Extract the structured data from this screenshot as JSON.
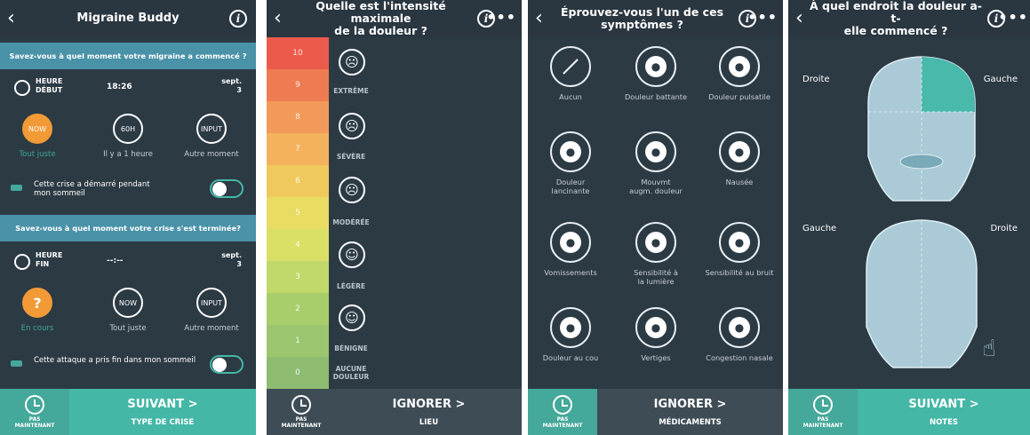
{
  "screen1": {
    "title": "Migraine Buddy",
    "q_start": "Savez-vous à quel moment votre migraine a commencé ?",
    "start_label": "HEURE\nDÉBUT",
    "start_time": "18:26",
    "start_date": "sept.\n3",
    "choices_start": [
      {
        "icon_text": "NOW",
        "caption": "Tout juste"
      },
      {
        "icon_text": "60H",
        "caption": "Il y a 1 heure"
      },
      {
        "icon_text": "INPUT",
        "caption": "Autre moment"
      }
    ],
    "sleep_start": "Cette crise a démarré pendant\nmon sommeil",
    "q_end": "Savez-vous à quel moment votre crise s'est terminée?",
    "end_label": "HEURE\nFIN",
    "end_time": "--:--",
    "end_date": "sept.\n3",
    "choices_end": [
      {
        "icon_text": "?",
        "caption": "En cours"
      },
      {
        "icon_text": "NOW",
        "caption": "Tout juste"
      },
      {
        "icon_text": "INPUT",
        "caption": "Autre moment"
      }
    ],
    "sleep_end": "Cette attaque a pris fin dans mon sommeil",
    "later_label": "PAS\nMAINTENANT",
    "next_label": "SUIVANT >",
    "next_sub": "TYPE DE CRISE"
  },
  "screen2": {
    "title": "Quelle est l'intensité maximale\nde la douleur ?",
    "scale": [
      "10",
      "9",
      "8",
      "7",
      "6",
      "5",
      "4",
      "3",
      "2",
      "1",
      "0"
    ],
    "scale_colors": [
      "#ec5a4b",
      "#ef7b52",
      "#f29a5a",
      "#f3b25b",
      "#f0c95d",
      "#e9dc62",
      "#d9e065",
      "#c1d86a",
      "#a8cd6d",
      "#9bc56f",
      "#8dbb6f"
    ],
    "levels": [
      {
        "label": "EXTRÊME",
        "icon": "face-extreme-icon"
      },
      {
        "label": "SÉVÈRE",
        "icon": "face-severe-icon"
      },
      {
        "label": "MODÉRÉE",
        "icon": "face-moderate-icon"
      },
      {
        "label": "LÉGÈRE",
        "icon": "face-mild-icon"
      },
      {
        "label": "BÉNIGNE",
        "icon": "face-benign-icon"
      },
      {
        "label": "AUCUNE\nDOULEUR",
        "icon": ""
      }
    ],
    "later_label": "PAS\nMAINTENANT",
    "next_label": "IGNORER >",
    "next_sub": "LIEU"
  },
  "screen3": {
    "title": "Éprouvez-vous l'un de ces\nsymptômes ?",
    "symptoms": [
      {
        "caption": "Aucun",
        "icon": "none-icon"
      },
      {
        "caption": "Douleur battante",
        "icon": "throbbing-pain-icon"
      },
      {
        "caption": "Douleur pulsatile",
        "icon": "pulsating-pain-icon"
      },
      {
        "caption": "Douleur\nlancinante",
        "icon": "stabbing-pain-icon"
      },
      {
        "caption": "Mouvmt\naugm. douleur",
        "icon": "movement-pain-icon"
      },
      {
        "caption": "Nausée",
        "icon": "nausea-icon"
      },
      {
        "caption": "Vomissements",
        "icon": "vomiting-icon"
      },
      {
        "caption": "Sensibilité à\nla lumière",
        "icon": "light-sensitivity-icon"
      },
      {
        "caption": "Sensibilité au bruit",
        "icon": "noise-sensitivity-icon"
      },
      {
        "caption": "Douleur au cou",
        "icon": "neck-pain-icon"
      },
      {
        "caption": "Vertiges",
        "icon": "dizziness-icon"
      },
      {
        "caption": "Congestion nasale",
        "icon": "nasal-congestion-icon"
      }
    ],
    "later_label": "PAS\nMAINTENANT",
    "next_label": "IGNORER >",
    "next_sub": "MÉDICAMENTS"
  },
  "screen4": {
    "title": "À quel endroit la douleur a-t-\nelle commencé ?",
    "front_left": "Droite",
    "front_right": "Gauche",
    "back_left": "Gauche",
    "back_right": "Droite",
    "later_label": "PAS\nMAINTENANT",
    "next_label": "SUIVANT >",
    "next_sub": "NOTES"
  }
}
